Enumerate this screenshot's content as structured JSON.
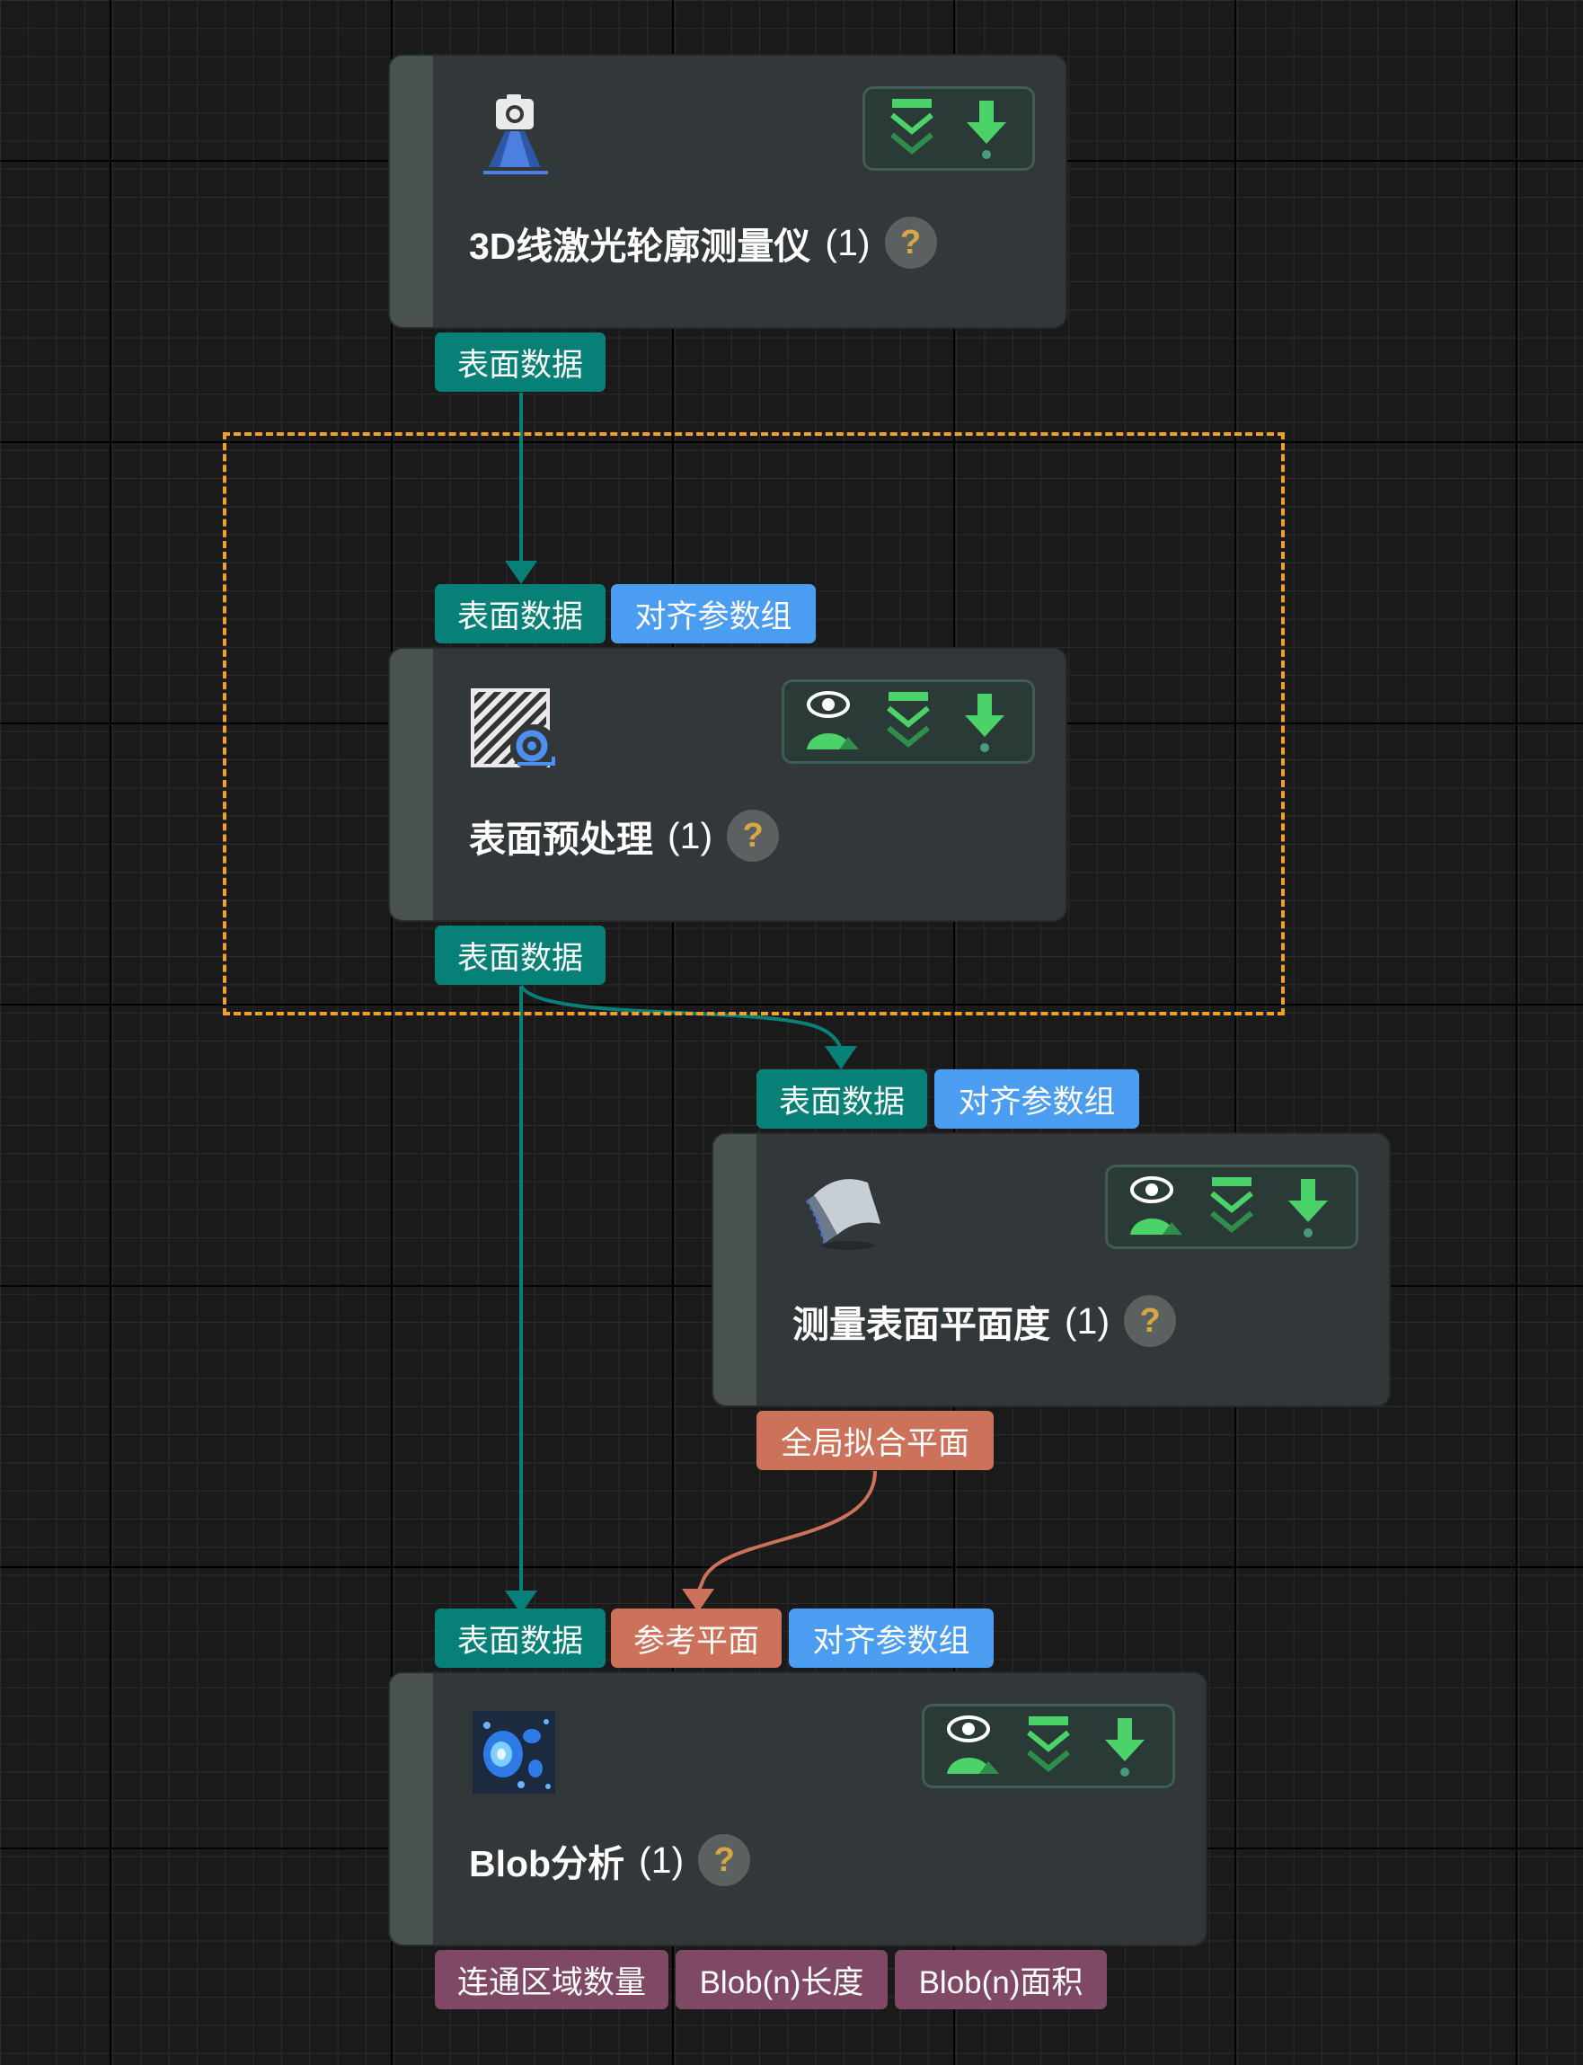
{
  "colors": {
    "surface_link": "#078077",
    "align_param": "#4b9df2",
    "plane_link": "#cd725a",
    "output_port": "#7f4865",
    "selection": "#f3a02a",
    "help_mark": "#d8a743",
    "tool_green": "#4bd36a"
  },
  "nodes": {
    "profiler": {
      "icon": "camera-laser-icon",
      "title": "3D线激光轮廓测量仪",
      "count": "(1)",
      "help": "?",
      "outputs": [
        "表面数据"
      ],
      "tools": [
        "step-into-icon",
        "download-icon"
      ]
    },
    "preprocess": {
      "icon": "surface-preprocess-icon",
      "title": "表面预处理",
      "count": "(1)",
      "help": "?",
      "inputs": [
        "表面数据",
        "对齐参数组"
      ],
      "outputs": [
        "表面数据"
      ],
      "tools": [
        "visualize-icon",
        "step-into-icon",
        "download-icon"
      ]
    },
    "flatness": {
      "icon": "surface-flatness-icon",
      "title": "测量表面平面度",
      "count": "(1)",
      "help": "?",
      "inputs": [
        "表面数据",
        "对齐参数组"
      ],
      "outputs": [
        "全局拟合平面"
      ],
      "tools": [
        "visualize-icon",
        "step-into-icon",
        "download-icon"
      ]
    },
    "blob": {
      "icon": "blob-analysis-icon",
      "title": "Blob分析",
      "count": "(1)",
      "help": "?",
      "inputs": [
        "表面数据",
        "参考平面",
        "对齐参数组"
      ],
      "outputs": [
        "连通区域数量",
        "Blob(n)长度",
        "Blob(n)面积"
      ],
      "tools": [
        "visualize-icon",
        "step-into-icon",
        "download-icon"
      ]
    }
  }
}
